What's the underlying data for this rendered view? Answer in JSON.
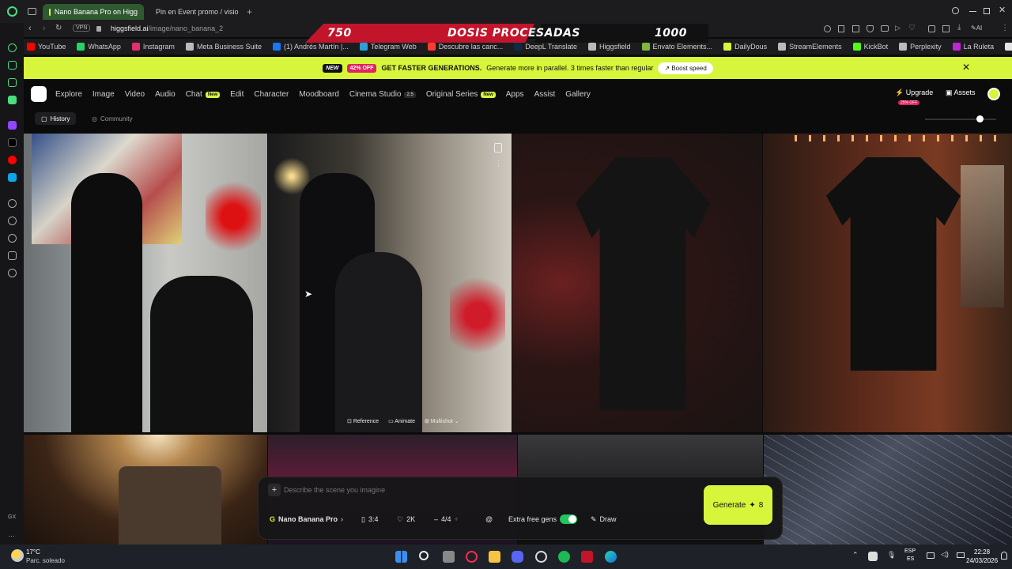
{
  "tabs": [
    {
      "title": "Nano Banana Pro on Higg",
      "active": true
    },
    {
      "title": "Pin en Event promo / visio",
      "active": false
    }
  ],
  "address": {
    "vpn": "VPN",
    "url_host": "higgsfield.ai",
    "url_path": "/image/nano_banana_2"
  },
  "bookmarks": [
    {
      "label": "YouTube",
      "color": "#ff0000"
    },
    {
      "label": "WhatsApp",
      "color": "#25d366"
    },
    {
      "label": "Instagram",
      "color": "#e1306c"
    },
    {
      "label": "Meta Business Suite",
      "color": "#bbbbbb"
    },
    {
      "label": "(1) Andrés Martín |...",
      "color": "#1877f2"
    },
    {
      "label": "Telegram Web",
      "color": "#2aa1da"
    },
    {
      "label": "Descubre las canc...",
      "color": "#ff3b30"
    },
    {
      "label": "DeepL Translate",
      "color": "#0f2b46"
    },
    {
      "label": "Higgsfield",
      "color": "#bbbbbb"
    },
    {
      "label": "Envato Elements...",
      "color": "#82b541"
    },
    {
      "label": "DailyDous",
      "color": "#d7f53a"
    },
    {
      "label": "StreamElements",
      "color": "#bbbbbb"
    },
    {
      "label": "KickBot",
      "color": "#53fc18"
    },
    {
      "label": "Perplexity",
      "color": "#bbbbbb"
    },
    {
      "label": "La Ruleta",
      "color": "#c026d3"
    },
    {
      "label": "ChatGPT",
      "color": "#e5e5e5"
    }
  ],
  "overlay": {
    "left_number": "750",
    "label": "DOSIS PROCESADAS",
    "right_number": "1000"
  },
  "promo": {
    "new_badge": "NEW",
    "off_badge": "42% OFF",
    "headline": "GET FASTER GENERATIONS.",
    "text": "Generate more in parallel. 3 times faster than regular",
    "boost_label": "Boost speed"
  },
  "nav": {
    "items": [
      {
        "label": "Explore",
        "badge": ""
      },
      {
        "label": "Image",
        "badge": ""
      },
      {
        "label": "Video",
        "badge": ""
      },
      {
        "label": "Audio",
        "badge": ""
      },
      {
        "label": "Chat",
        "badge": "New"
      },
      {
        "label": "Edit",
        "badge": ""
      },
      {
        "label": "Character",
        "badge": ""
      },
      {
        "label": "Moodboard",
        "badge": ""
      },
      {
        "label": "Cinema Studio",
        "badge": "2.5"
      },
      {
        "label": "Original Series",
        "badge": "New"
      },
      {
        "label": "Apps",
        "badge": ""
      },
      {
        "label": "Assist",
        "badge": ""
      },
      {
        "label": "Gallery",
        "badge": ""
      }
    ],
    "upgrade_label": "Upgrade",
    "upgrade_badge": "25% OFF",
    "assets_label": "Assets"
  },
  "subnav": {
    "history": "History",
    "community": "Community"
  },
  "image_actions": {
    "reference": "Reference",
    "animate": "Animate",
    "multishot": "Multishot"
  },
  "prompt": {
    "placeholder": "Describe the scene you imagine",
    "model": "Nano Banana Pro",
    "ratio": "3:4",
    "quality": "2K",
    "count": "4/4",
    "extra_gens_label": "Extra free gens",
    "extra_gens_on": true,
    "draw_label": "Draw",
    "generate_label": "Generate",
    "generate_cost": "8"
  },
  "taskbar": {
    "weather_temp": "17°C",
    "weather_desc": "Parc. soleado",
    "lang_top": "ESP",
    "lang_bottom": "ES",
    "time": "22:28",
    "date": "24/03/2026"
  },
  "colors": {
    "accent": "#d7f53a",
    "counter_red": "#c2142b"
  }
}
